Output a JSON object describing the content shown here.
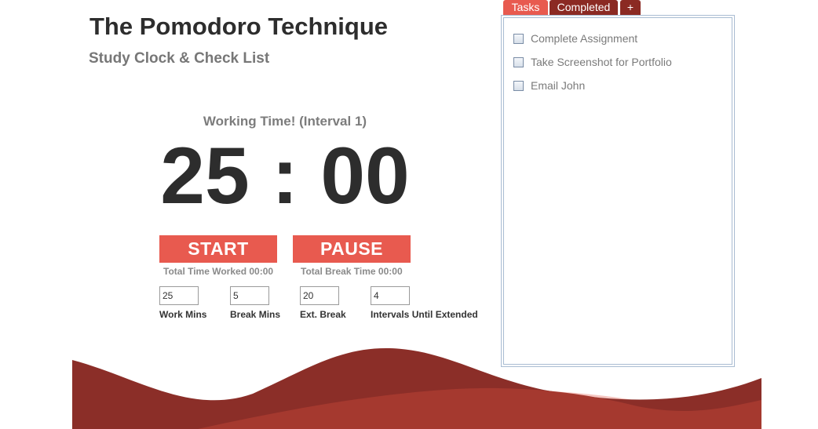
{
  "header": {
    "title": "The Pomodoro Technique",
    "subtitle": "Study Clock & Check List"
  },
  "timer": {
    "status": "Working Time! (Interval 1)",
    "display": "25 : 00",
    "start_label": "START",
    "pause_label": "PAUSE",
    "total_worked": "Total Time Worked 00:00",
    "total_break": "Total Break Time 00:00"
  },
  "settings": {
    "work_mins": {
      "value": "25",
      "label": "Work Mins"
    },
    "break_mins": {
      "value": "5",
      "label": "Break Mins"
    },
    "ext_break": {
      "value": "20",
      "label": "Ext. Break"
    },
    "intervals": {
      "value": "4",
      "label": "Intervals Until Extended"
    }
  },
  "tabs": [
    {
      "label": "Tasks",
      "active": true
    },
    {
      "label": "Completed",
      "active": false
    },
    {
      "label": "+",
      "active": false
    }
  ],
  "tasks": [
    {
      "label": "Complete Assignment",
      "checked": false
    },
    {
      "label": "Take Screenshot for Portfolio",
      "checked": false
    },
    {
      "label": "Email John",
      "checked": false
    }
  ],
  "colors": {
    "accent": "#e85a4f",
    "tab_dark": "#8b2a23",
    "wave_dark": "#8b2e28",
    "wave_mid": "#a5392f",
    "wave_light": "#f5c6c1",
    "title_text": "#2d2d2d",
    "muted_text": "#777777"
  }
}
